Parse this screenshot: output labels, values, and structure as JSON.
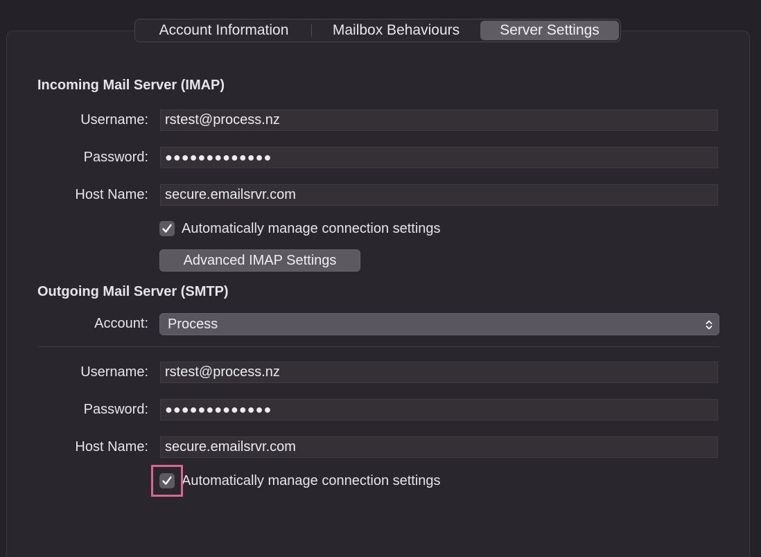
{
  "tabs": {
    "account_information": "Account Information",
    "mailbox_behaviours": "Mailbox Behaviours",
    "server_settings": "Server Settings",
    "selected": "Server Settings"
  },
  "incoming": {
    "title": "Incoming Mail Server (IMAP)",
    "username_label": "Username:",
    "username_value": "rstest@process.nz",
    "password_label": "Password:",
    "password_value": "●●●●●●●●●●●●●",
    "hostname_label": "Host Name:",
    "hostname_value": "secure.emailsrvr.com",
    "auto_manage_label": "Automatically manage connection settings",
    "auto_manage_checked": true,
    "advanced_button": "Advanced IMAP Settings"
  },
  "outgoing": {
    "title": "Outgoing Mail Server (SMTP)",
    "account_label": "Account:",
    "account_value": "Process",
    "username_label": "Username:",
    "username_value": "rstest@process.nz",
    "password_label": "Password:",
    "password_value": "●●●●●●●●●●●●●",
    "hostname_label": "Host Name:",
    "hostname_value": "secure.emailsrvr.com",
    "auto_manage_label": "Automatically manage connection settings",
    "auto_manage_checked": true
  },
  "colors": {
    "background": "#252128",
    "panel": "#2a262d",
    "selected_tab": "#605c64",
    "highlight": "#d9688f"
  }
}
